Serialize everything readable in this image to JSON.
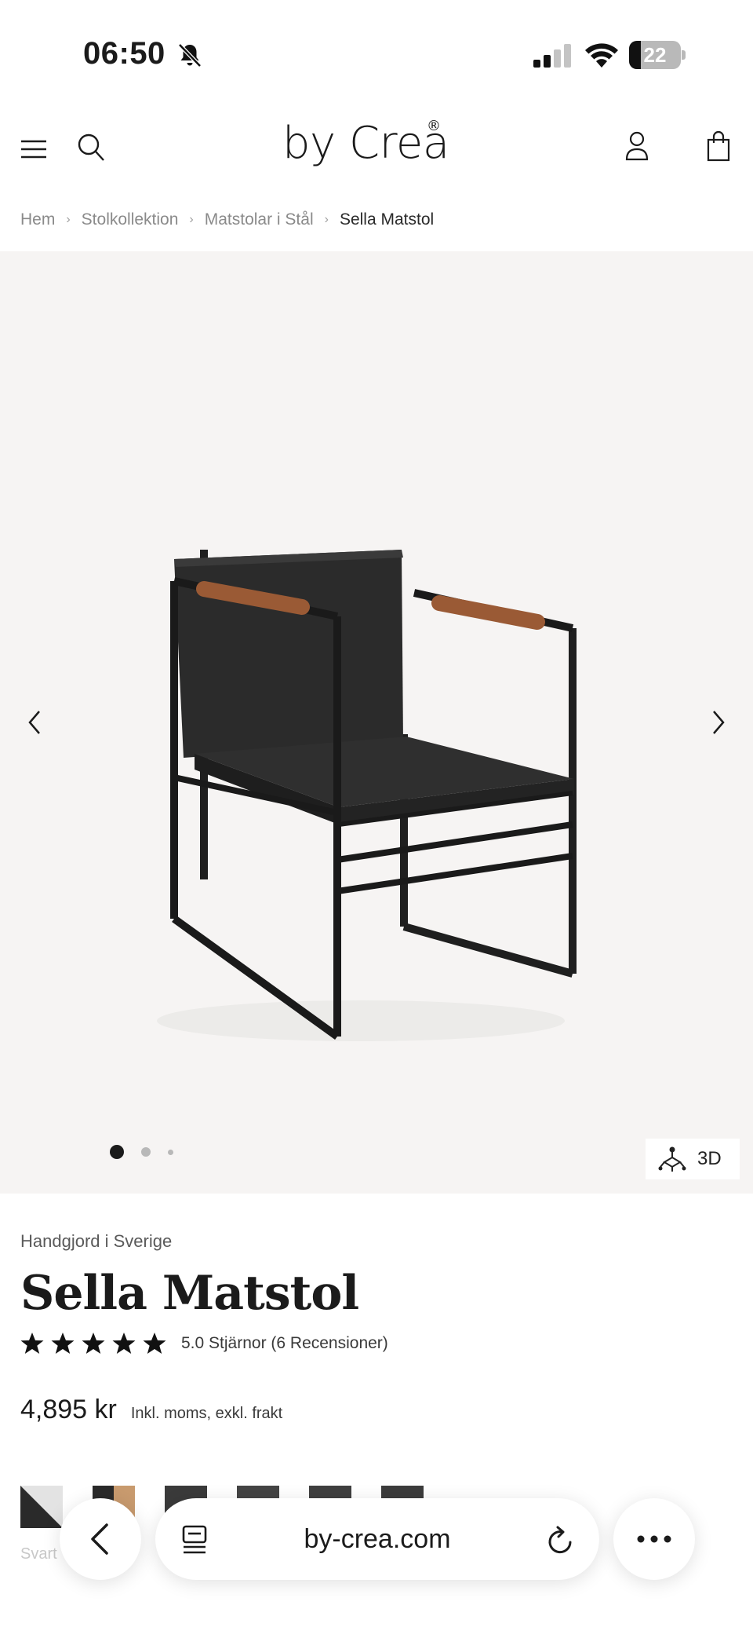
{
  "status_bar": {
    "time": "06:50",
    "battery_level": "22",
    "battery_fraction": 0.22
  },
  "header": {
    "logo": "by Crea",
    "logo_mark": "®",
    "icons": [
      "menu-icon",
      "search-icon",
      "account-icon",
      "cart-icon"
    ]
  },
  "breadcrumb": {
    "items": [
      "Hem",
      "Stolkollektion",
      "Matstolar i Stål",
      "Sella Matstol"
    ],
    "separator": "›"
  },
  "gallery": {
    "image_count": 3,
    "active_index": 0,
    "button_3d": "3D",
    "background": "#f6f4f3"
  },
  "product": {
    "origin": "Handgjord i Sverige",
    "name": "Sella Matstol",
    "rating": 5.0,
    "rating_text": "5.0 Stjärnor (6 Recensioner)",
    "price": "4,895 kr",
    "price_note": "Inkl. moms, exkl. frakt",
    "swatch_label_visible": "Svart"
  },
  "browser": {
    "url": "by-crea.com"
  }
}
